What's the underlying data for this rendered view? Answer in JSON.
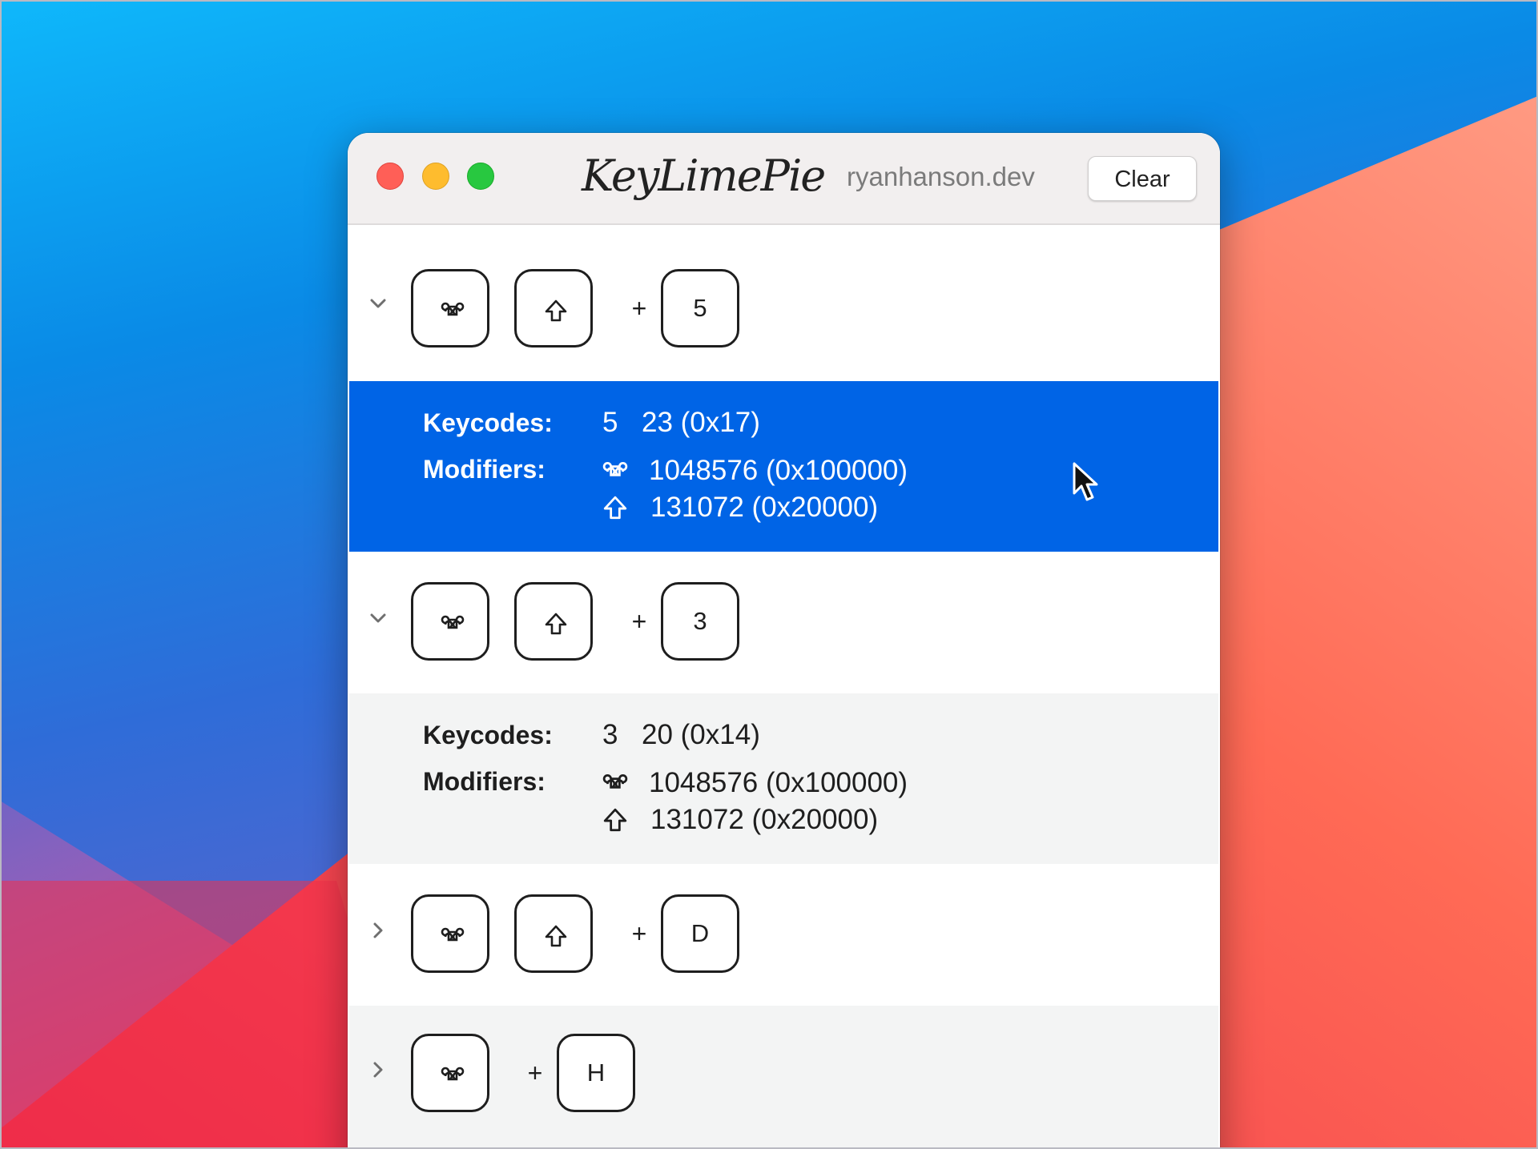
{
  "app": {
    "logo": "KeyLimePie",
    "domain": "ryanhanson.dev",
    "clear_label": "Clear"
  },
  "window_controls": {
    "close": "close-button",
    "minimize": "minimize-button",
    "maximize": "maximize-button"
  },
  "icons": {
    "command": "command-icon",
    "shift": "shift-icon",
    "chevron_down": "chevron-down-icon",
    "chevron_right": "chevron-right-icon",
    "cursor": "mouse-pointer-icon"
  },
  "colors": {
    "selection": "#0064e6",
    "close": "#ff5f57",
    "minimize": "#febc2e",
    "maximize": "#28c840"
  },
  "plus_sign": "+",
  "shortcuts": [
    {
      "expanded": true,
      "selected": true,
      "keys": [
        "⌘",
        "⇧"
      ],
      "key": "5",
      "keycodes_label": "Keycodes:",
      "keycode_char": "5",
      "keycode_value": "23 (0x17)",
      "modifiers_label": "Modifiers:",
      "modifiers": [
        {
          "icon": "command-icon",
          "value": "1048576 (0x100000)"
        },
        {
          "icon": "shift-icon",
          "value": "131072 (0x20000)"
        }
      ]
    },
    {
      "expanded": true,
      "selected": false,
      "keys": [
        "⌘",
        "⇧"
      ],
      "key": "3",
      "keycodes_label": "Keycodes:",
      "keycode_char": "3",
      "keycode_value": "20 (0x14)",
      "modifiers_label": "Modifiers:",
      "modifiers": [
        {
          "icon": "command-icon",
          "value": "1048576 (0x100000)"
        },
        {
          "icon": "shift-icon",
          "value": "131072 (0x20000)"
        }
      ]
    },
    {
      "expanded": false,
      "keys": [
        "⌘",
        "⇧"
      ],
      "key": "D"
    },
    {
      "expanded": false,
      "keys": [
        "⌘"
      ],
      "key": "H"
    }
  ]
}
